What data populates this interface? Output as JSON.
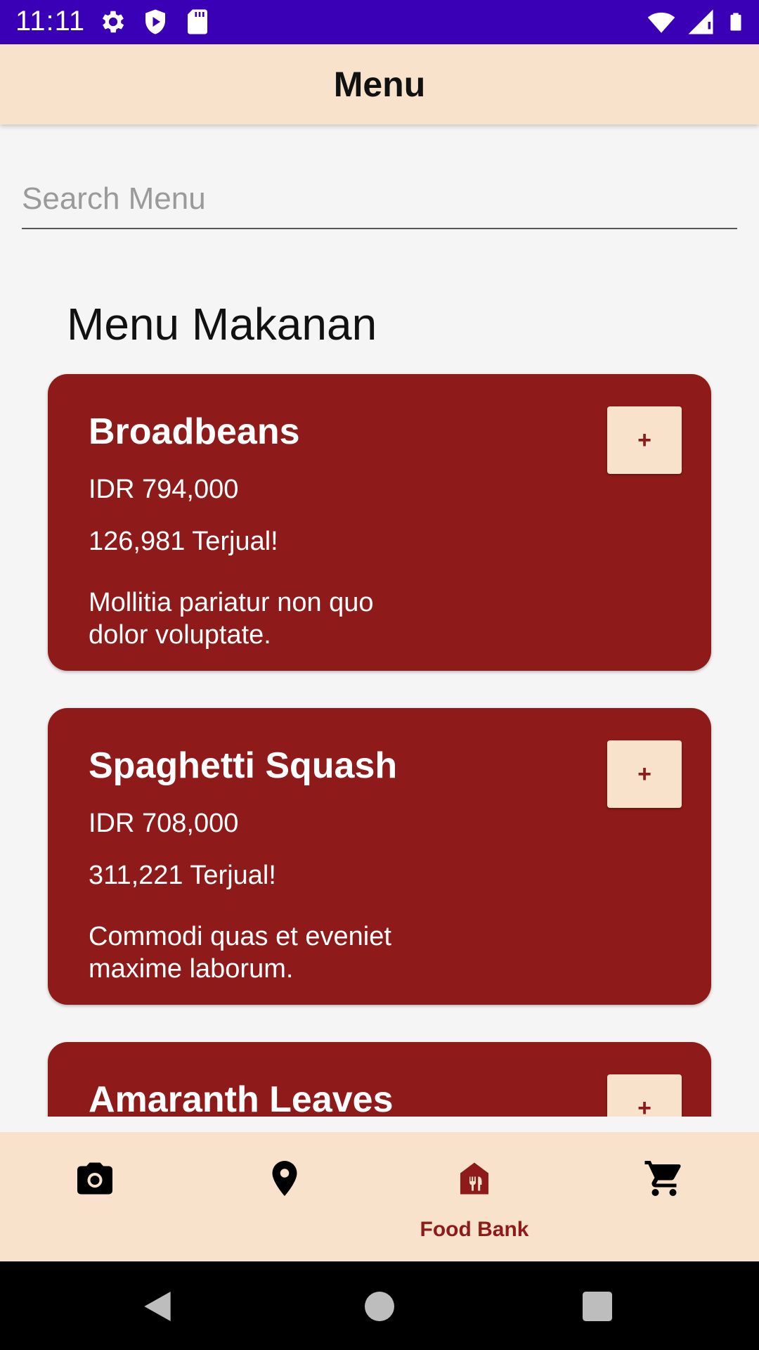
{
  "status_bar": {
    "time": "11:11",
    "icons": [
      "gear-icon",
      "shield-icon",
      "sd-card-icon",
      "wifi-icon",
      "signal-icon",
      "battery-icon"
    ],
    "background": "#3a00b5"
  },
  "app_bar": {
    "title": "Menu",
    "background": "#f8e2cb"
  },
  "search": {
    "placeholder": "Search Menu",
    "value": ""
  },
  "section": {
    "title": "Menu Makanan"
  },
  "menu_items": [
    {
      "name": "Broadbeans",
      "price": "IDR 794,000",
      "sold": "126,981 Terjual!",
      "description": "Mollitia pariatur non quo dolor voluptate.",
      "add_label": "+"
    },
    {
      "name": "Spaghetti Squash",
      "price": "IDR 708,000",
      "sold": "311,221 Terjual!",
      "description": "Commodi quas et eveniet maxime laborum.",
      "add_label": "+"
    },
    {
      "name": "Amaranth Leaves",
      "add_label": "+"
    }
  ],
  "bottom_nav": {
    "items": [
      {
        "icon": "camera-icon",
        "label": "",
        "selected": false
      },
      {
        "icon": "location-pin-icon",
        "label": "",
        "selected": false
      },
      {
        "icon": "food-bank-icon",
        "label": "Food Bank",
        "selected": true
      },
      {
        "icon": "shopping-cart-icon",
        "label": "",
        "selected": false
      }
    ]
  },
  "colors": {
    "card": "#8e1b19",
    "accent": "#8e1b19",
    "surface": "#f8e2cb"
  }
}
